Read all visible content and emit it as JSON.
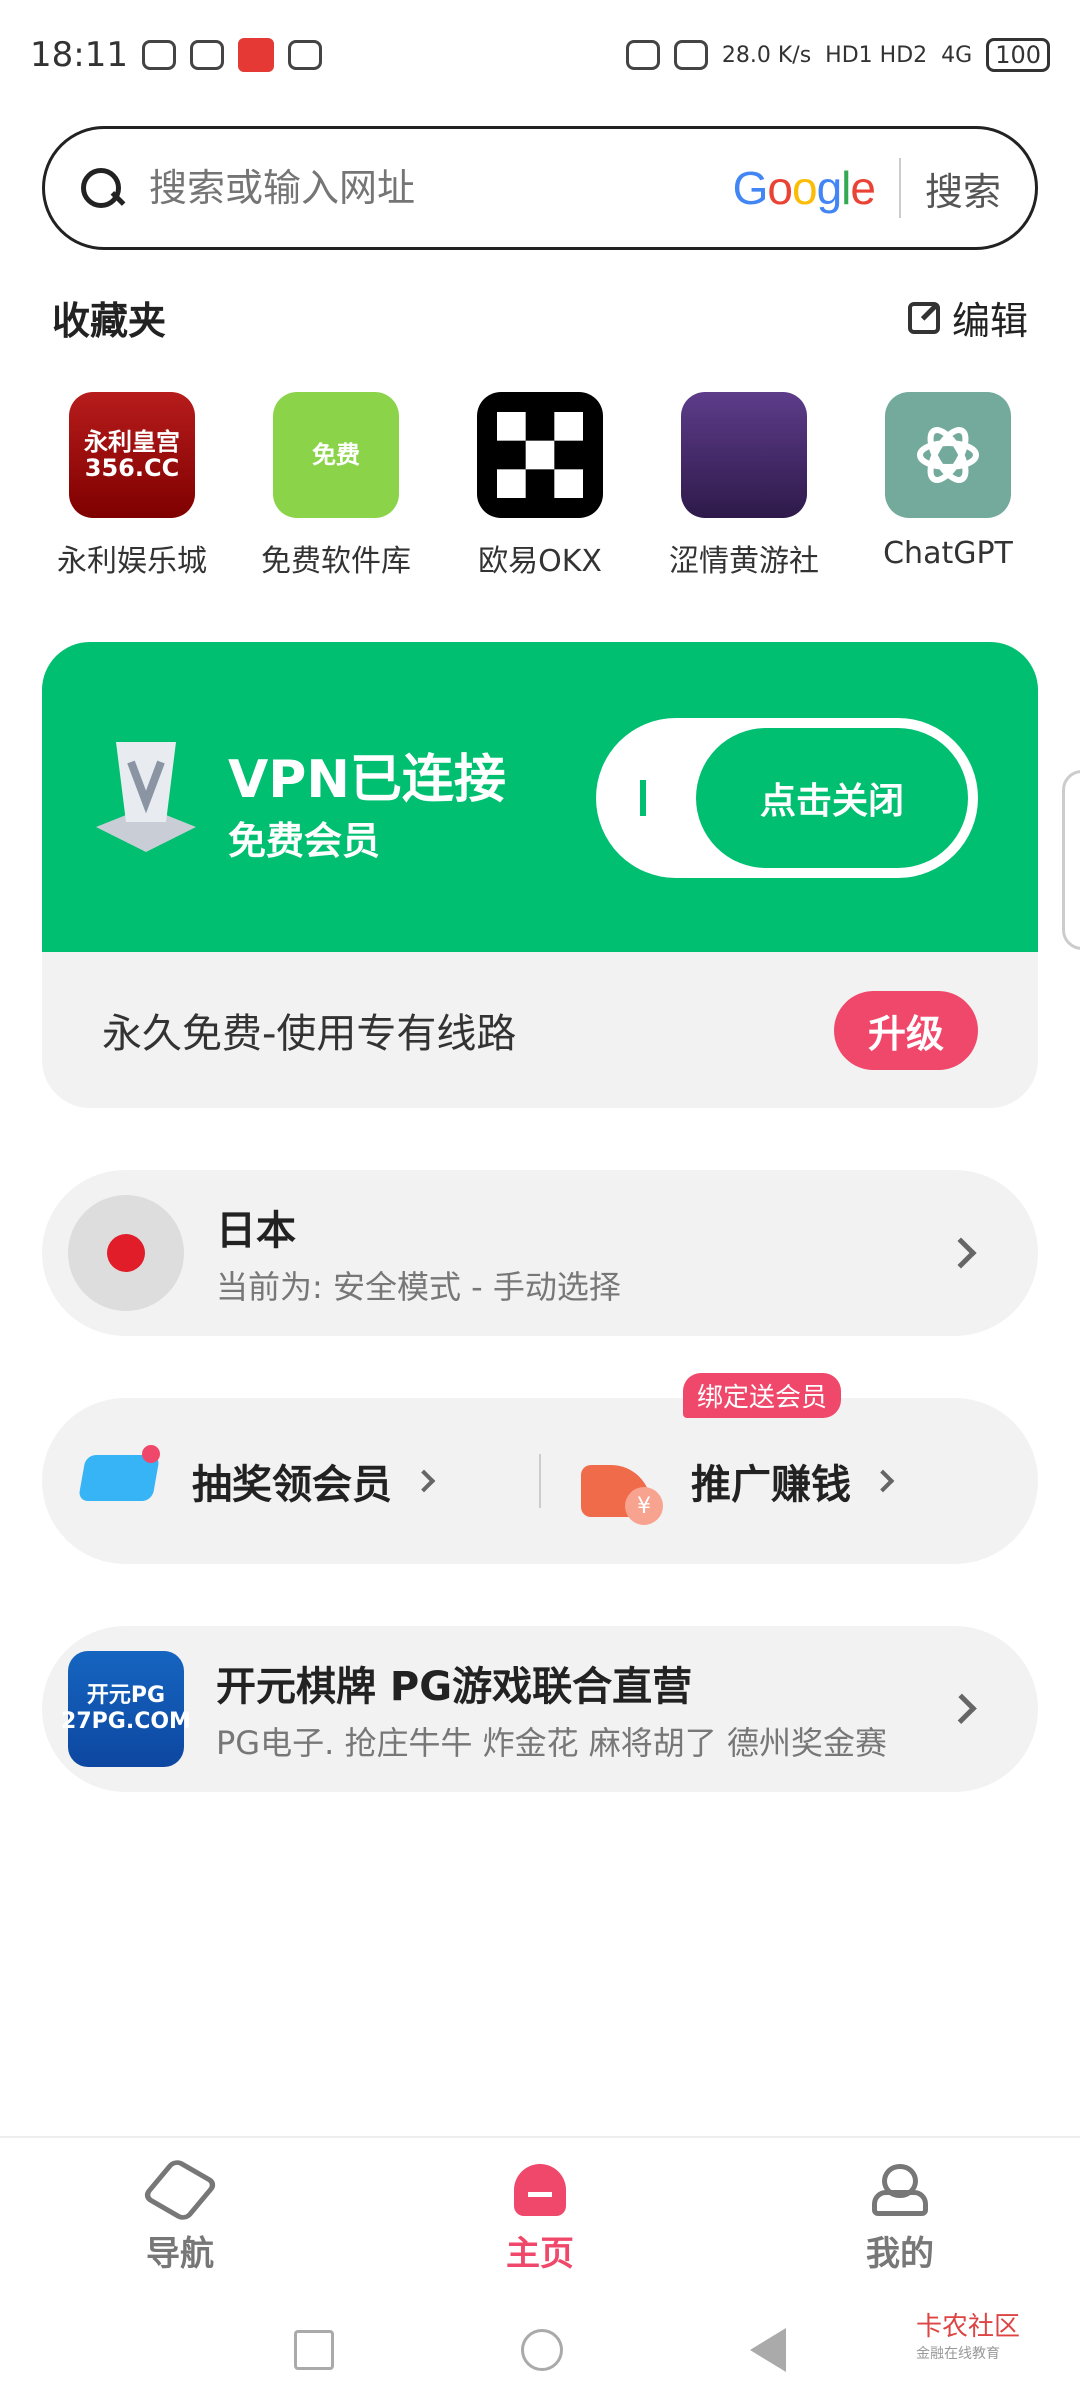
{
  "status_bar": {
    "time": "18:11",
    "net_speed": "28.0",
    "net_unit": "K/s",
    "hd": "HD1 HD2",
    "signal": "4G",
    "battery": "100"
  },
  "search": {
    "placeholder": "搜索或输入网址",
    "engine": "Google",
    "button": "搜索"
  },
  "favorites": {
    "title": "收藏夹",
    "edit_label": "编辑",
    "items": [
      {
        "label": "永利娱乐城",
        "icon_text": "永利皇宫 356.CC"
      },
      {
        "label": "免费软件库",
        "icon_text": "免费"
      },
      {
        "label": "欧易OKX",
        "icon_text": ""
      },
      {
        "label": "涩情黄游社",
        "icon_text": ""
      },
      {
        "label": "ChatGPT",
        "icon_text": ""
      }
    ]
  },
  "vpn": {
    "title": "VPN已连接",
    "subtitle": "免费会员",
    "toggle_label": "点击关闭",
    "plan_text": "永久免费-使用专有线路",
    "upgrade_label": "升级"
  },
  "server": {
    "country": "日本",
    "mode": "当前为: 安全模式 - 手动选择"
  },
  "promo": {
    "lottery_label": "抽奖领会员",
    "share_label": "推广赚钱",
    "share_badge": "绑定送会员",
    "share_icon_text": "¥"
  },
  "ad": {
    "icon_text": "开元PG 27PG.COM",
    "title": "开元棋牌 PG游戏联合直营",
    "subtitle": "PG电子. 抢庄牛牛 炸金花  麻将胡了 德州奖金赛"
  },
  "bottom_nav": {
    "items": [
      {
        "label": "导航"
      },
      {
        "label": "主页"
      },
      {
        "label": "我的"
      }
    ]
  },
  "watermark": {
    "main": "卡农社区",
    "sub": "金融在线教育"
  },
  "colors": {
    "accent_green": "#01bf71",
    "accent_pink": "#f0486a"
  }
}
